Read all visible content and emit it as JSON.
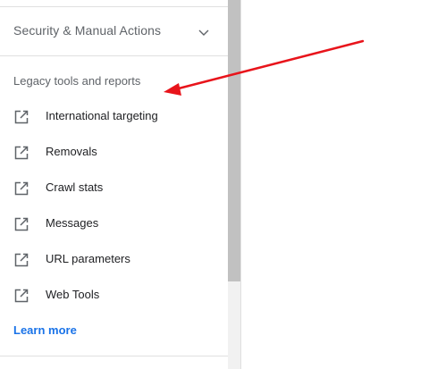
{
  "sidebar": {
    "section_header": {
      "label": "Security & Manual Actions",
      "icon": "chevron-down-icon"
    },
    "legacy": {
      "title": "Legacy tools and reports",
      "items": [
        {
          "label": "International targeting",
          "icon": "open-in-new-icon"
        },
        {
          "label": "Removals",
          "icon": "open-in-new-icon"
        },
        {
          "label": "Crawl stats",
          "icon": "open-in-new-icon"
        },
        {
          "label": "Messages",
          "icon": "open-in-new-icon"
        },
        {
          "label": "URL parameters",
          "icon": "open-in-new-icon"
        },
        {
          "label": "Web Tools",
          "icon": "open-in-new-icon"
        }
      ],
      "learn_more": "Learn more"
    }
  },
  "annotation": {
    "type": "arrow",
    "color": "#e8141b"
  },
  "colors": {
    "link": "#1a73e8",
    "text_primary": "#202124",
    "text_secondary": "#5f6368",
    "divider": "#e0e0e0",
    "scrollbar_thumb": "#c1c1c1"
  }
}
